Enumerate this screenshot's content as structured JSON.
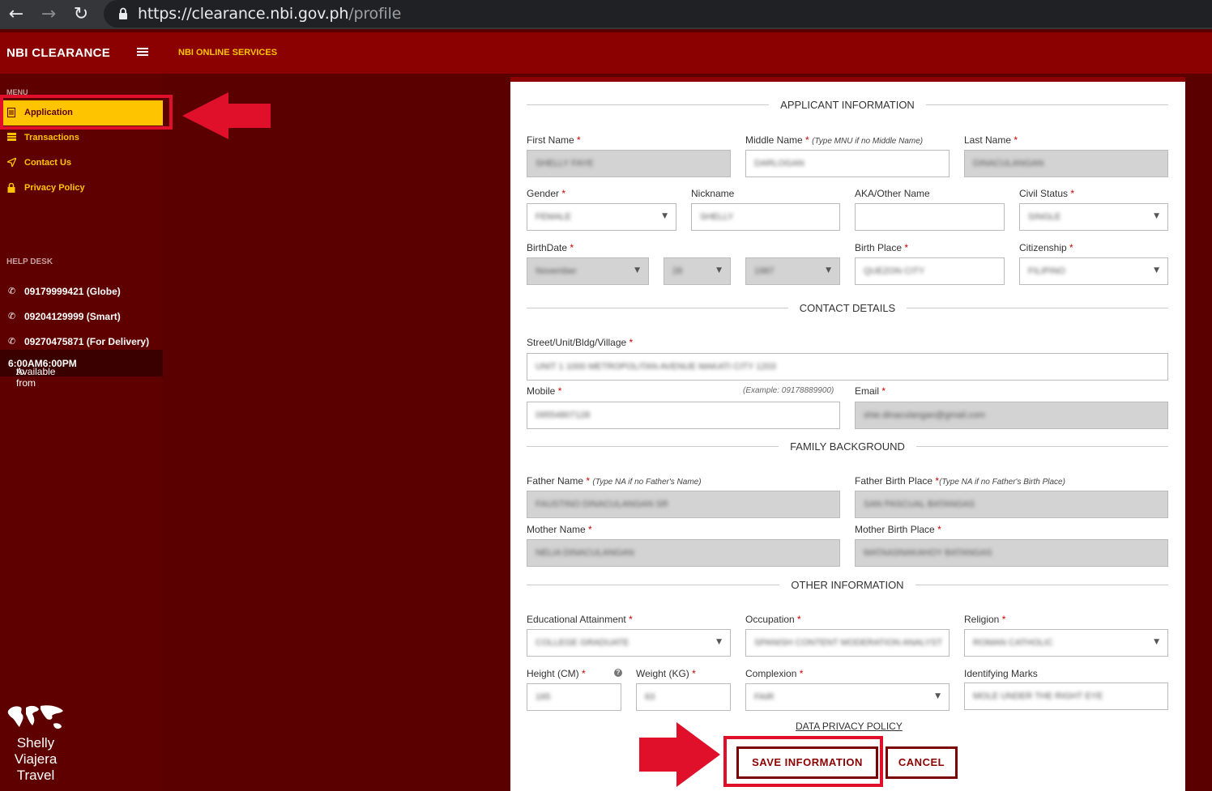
{
  "browser": {
    "url_host": "https://clearance.nbi.gov.ph",
    "url_path": "/profile"
  },
  "header": {
    "brand": "NBI CLEARANCE",
    "nav_link": "NBI ONLINE SERVICES"
  },
  "sidebar": {
    "menu_title": "MENU",
    "items": [
      {
        "label": "Application",
        "icon": "document-icon",
        "active": true
      },
      {
        "label": "Transactions",
        "icon": "list-icon"
      },
      {
        "label": "Contact Us",
        "icon": "send-icon"
      },
      {
        "label": "Privacy Policy",
        "icon": "lock-icon"
      }
    ],
    "help_title": "HELP DESK",
    "phones": [
      {
        "label": "09179999421 (Globe)"
      },
      {
        "label": "09204129999 (Smart)"
      },
      {
        "label": "09270475871 (For Delivery)"
      }
    ],
    "availability_prefix": "Available from ",
    "availability_start": "6:00AM",
    "availability_mid": " to ",
    "availability_end": "6:00PM",
    "logo_lines": [
      "Shelly",
      "Viajera",
      "Travel"
    ]
  },
  "form": {
    "sections": {
      "applicant": "APPLICANT INFORMATION",
      "contact": "CONTACT DETAILS",
      "family": "FAMILY BACKGROUND",
      "other": "OTHER INFORMATION"
    },
    "labels": {
      "first_name": "First Name",
      "middle_name": "Middle Name",
      "middle_name_hint": "(Type MNU if no Middle Name)",
      "last_name": "Last Name",
      "gender": "Gender",
      "nickname": "Nickname",
      "aka": "AKA/Other Name",
      "civil_status": "Civil Status",
      "birthdate": "BirthDate",
      "birth_place": "Birth Place",
      "citizenship": "Citizenship",
      "street": "Street/Unit/Bldg/Village",
      "mobile": "Mobile",
      "mobile_example": "(Example: 09178889900)",
      "email": "Email",
      "father_name": "Father Name",
      "father_name_hint": "(Type NA if no Father's Name)",
      "father_birth_place": "Father Birth Place",
      "father_birth_place_hint": "(Type NA if no Father's Birth Place)",
      "mother_name": "Mother Name",
      "mother_birth_place": "Mother Birth Place",
      "education": "Educational Attainment",
      "occupation": "Occupation",
      "religion": "Religion",
      "height": "Height (CM)",
      "weight": "Weight (KG)",
      "complexion": "Complexion",
      "identifying_marks": "Identifying Marks",
      "required_mark": "*"
    },
    "values": {
      "first_name": "SHELLY FAYE",
      "middle_name": "DARLOGAN",
      "last_name": "DINACULANGAN",
      "gender": "FEMALE",
      "nickname": "SHELLY",
      "aka": "",
      "civil_status": "SINGLE",
      "birth_month": "November",
      "birth_day": "28",
      "birth_year": "1987",
      "birth_place": "QUEZON CITY",
      "citizenship": "FILIPINO",
      "street": "UNIT 1 1000 METROPOLITAN AVENUE MAKATI CITY 1203",
      "mobile": "09554807128",
      "email": "shie.dinaculangan@gmail.com",
      "father_name": "FAUSTINO DINACULANGAN SR",
      "father_birth_place": "SAN PASCUAL BATANGAS",
      "mother_name": "NELIA DINACULANGAN",
      "mother_birth_place": "MATAASNAKAHOY BATANGAS",
      "education": "COLLEGE GRADUATE",
      "occupation": "SPANISH CONTENT MODERATION ANALYST",
      "religion": "ROMAN CATHOLIC",
      "height": "165",
      "weight": "63",
      "complexion": "FAIR",
      "identifying_marks": "MOLE UNDER THE RIGHT EYE"
    },
    "privacy_link": "DATA PRIVACY POLICY",
    "save_label": "SAVE INFORMATION",
    "cancel_label": "CANCEL"
  },
  "colors": {
    "header_red": "#8b0000",
    "sidebar_bg": "#5e0000",
    "accent_yellow": "#ffc400",
    "annotation_red": "#e0102a"
  }
}
